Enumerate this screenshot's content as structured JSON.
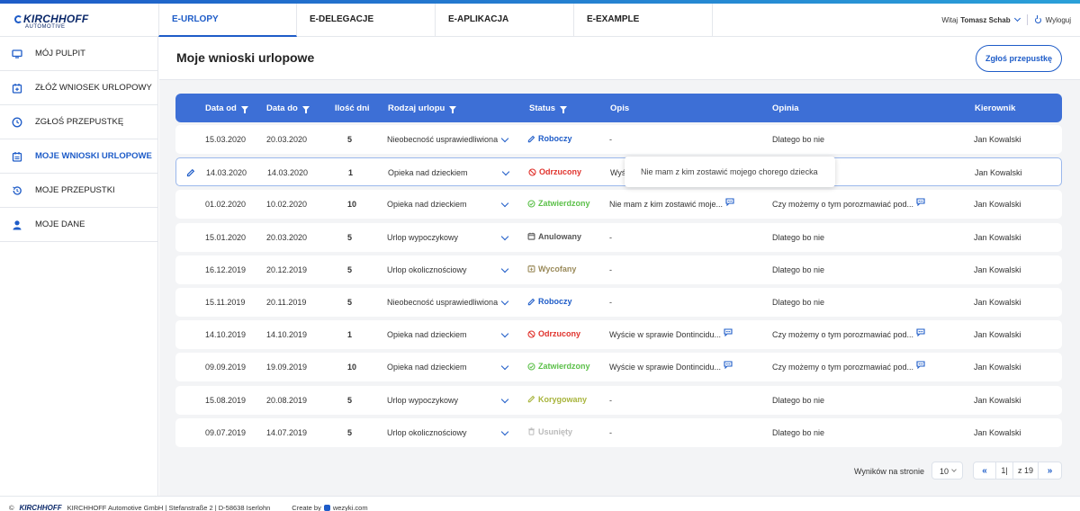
{
  "logo": {
    "main": "KIRCHHOFF",
    "sub": "AUTOMOTIVE"
  },
  "tabs": [
    {
      "label": "E-URLOPY",
      "active": true
    },
    {
      "label": "E-DELEGACJE",
      "active": false
    },
    {
      "label": "E-APLIKACJA",
      "active": false
    },
    {
      "label": "E-EXAMPLE",
      "active": false
    }
  ],
  "user": {
    "greeting": "Witaj",
    "name": "Tomasz Schab",
    "logout": "Wyloguj"
  },
  "sidebar": {
    "items": [
      {
        "label": "MÓJ PULPIT",
        "icon": "monitor-icon",
        "active": false
      },
      {
        "label": "ZŁÓŻ WNIOSEK URLOPOWY",
        "icon": "calendar-plus-icon",
        "active": false
      },
      {
        "label": "ZGŁOŚ PRZEPUSTKĘ",
        "icon": "clock-icon",
        "active": false
      },
      {
        "label": "MOJE WNIOSKI URLOPOWE",
        "icon": "calendar-icon",
        "active": true
      },
      {
        "label": "MOJE PRZEPUSTKI",
        "icon": "history-icon",
        "active": false
      },
      {
        "label": "MOJE DANE",
        "icon": "user-icon",
        "active": false
      }
    ]
  },
  "page": {
    "title": "Moje wnioski urlopowe",
    "action_button": "Zgłoś przepustkę"
  },
  "table": {
    "headers": {
      "date_from": "Data od",
      "date_to": "Data do",
      "days": "Ilość dni",
      "type": "Rodzaj urlopu",
      "status": "Status",
      "description": "Opis",
      "opinion": "Opinia",
      "manager": "Kierownik"
    },
    "rows": [
      {
        "date_from": "15.03.2020",
        "date_to": "20.03.2020",
        "days": "5",
        "type": "Nieobecność usprawiedliwiona",
        "status": "Roboczy",
        "status_kind": "draft",
        "description": "-",
        "desc_comment": false,
        "opinion": "Dlatego bo nie",
        "op_comment": false,
        "manager": "Jan Kowalski"
      },
      {
        "date_from": "14.03.2020",
        "date_to": "14.03.2020",
        "days": "1",
        "type": "Opieka nad dzieckiem",
        "status": "Odrzucony",
        "status_kind": "rejected",
        "description": "Wyś",
        "desc_comment": false,
        "opinion": "",
        "op_comment": false,
        "manager": "Jan Kowalski",
        "editing": true
      },
      {
        "date_from": "01.02.2020",
        "date_to": "10.02.2020",
        "days": "10",
        "type": "Opieka nad dzieckiem",
        "status": "Zatwierdzony",
        "status_kind": "approved",
        "description": "Nie mam z kim zostawić moje...",
        "desc_comment": true,
        "opinion": "Czy możemy o tym porozmawiać pod...",
        "op_comment": true,
        "manager": "Jan Kowalski"
      },
      {
        "date_from": "15.01.2020",
        "date_to": "20.03.2020",
        "days": "5",
        "type": "Urlop wypoczykowy",
        "status": "Anulowany",
        "status_kind": "cancelled",
        "description": "-",
        "desc_comment": false,
        "opinion": "Dlatego bo nie",
        "op_comment": false,
        "manager": "Jan Kowalski"
      },
      {
        "date_from": "16.12.2019",
        "date_to": "20.12.2019",
        "days": "5",
        "type": "Urlop okolicznościowy",
        "status": "Wycofany",
        "status_kind": "withdrawn",
        "description": "-",
        "desc_comment": false,
        "opinion": "Dlatego bo nie",
        "op_comment": false,
        "manager": "Jan Kowalski"
      },
      {
        "date_from": "15.11.2019",
        "date_to": "20.11.2019",
        "days": "5",
        "type": "Nieobecność usprawiedliwiona",
        "status": "Roboczy",
        "status_kind": "draft",
        "description": "-",
        "desc_comment": false,
        "opinion": "Dlatego bo nie",
        "op_comment": false,
        "manager": "Jan Kowalski"
      },
      {
        "date_from": "14.10.2019",
        "date_to": "14.10.2019",
        "days": "1",
        "type": "Opieka nad dzieckiem",
        "status": "Odrzucony",
        "status_kind": "rejected",
        "description": "Wyście w sprawie Dontincidu...",
        "desc_comment": true,
        "opinion": "Czy możemy o tym porozmawiać pod...",
        "op_comment": true,
        "manager": "Jan Kowalski"
      },
      {
        "date_from": "09.09.2019",
        "date_to": "19.09.2019",
        "days": "10",
        "type": "Opieka nad dzieckiem",
        "status": "Zatwierdzony",
        "status_kind": "approved",
        "description": "Wyście w sprawie Dontincidu...",
        "desc_comment": true,
        "opinion": "Czy możemy o tym porozmawiać pod...",
        "op_comment": true,
        "manager": "Jan Kowalski"
      },
      {
        "date_from": "15.08.2019",
        "date_to": "20.08.2019",
        "days": "5",
        "type": "Urlop wypoczykowy",
        "status": "Korygowany",
        "status_kind": "corrected",
        "description": "-",
        "desc_comment": false,
        "opinion": "Dlatego bo nie",
        "op_comment": false,
        "manager": "Jan Kowalski"
      },
      {
        "date_from": "09.07.2019",
        "date_to": "14.07.2019",
        "days": "5",
        "type": "Urlop okolicznościowy",
        "status": "Usunięty",
        "status_kind": "deleted",
        "description": "-",
        "desc_comment": false,
        "opinion": "Dlatego bo nie",
        "op_comment": false,
        "manager": "Jan Kowalski"
      }
    ]
  },
  "tooltip": {
    "text": "Nie mam z kim zostawić mojego chorego dziecka"
  },
  "pagination": {
    "per_page_label": "Wyników na stronie",
    "per_page": "10",
    "current_page": "1|",
    "total": "z 19"
  },
  "footer": {
    "copyright": "©",
    "logo": "KIRCHHOFF",
    "company": "KIRCHHOFF Automotive GmbH | Stefanstraße 2 | D-58638 Iserlohn",
    "created": "Create by",
    "creator": "wezyki.com"
  },
  "status_colors": {
    "draft": "#1e5cc8",
    "rejected": "#e0332d",
    "approved": "#5cc04a",
    "cancelled": "#555555",
    "withdrawn": "#9a8a5a",
    "corrected": "#a8b43c",
    "deleted": "#bbbbbb"
  }
}
